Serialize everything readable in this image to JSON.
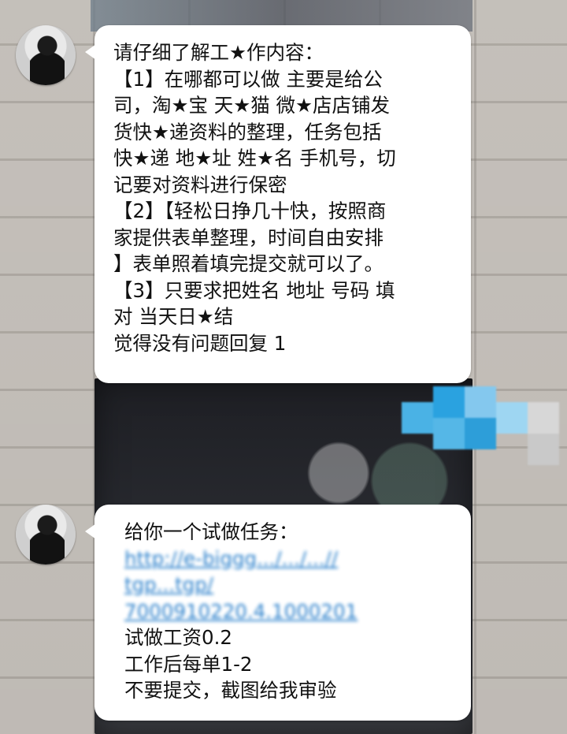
{
  "chat": {
    "messages": [
      {
        "sender_avatar": "avatar",
        "lines": [
          "请仔细了解工★作内容：",
          "【1】在哪都可以做   主要是给公",
          "司，淘★宝 天★猫 微★店店铺发",
          "货快★递资料的整理，任务包括",
          "快★递 地★址 姓★名 手机号，切",
          "记要对资料进行保密",
          "【2】【轻松日挣几十快，按照商",
          "家提供表单整理，时间自由安排",
          "】表单照着填完提交就可以了。",
          "【3】只要求把姓名 地址 号码 填",
          "对  当天日★结",
          "觉得没有问题回复  1"
        ]
      },
      {
        "sender_avatar": "avatar",
        "intro": "给你一个试做任务：",
        "blurred_link_lines": [
          "http://e-biggg.../.../...//",
          "tgp...tgp/",
          "7000910220.4.1000201"
        ],
        "tail_lines": [
          "试做工资0.2",
          "工作后每单1-2",
          "不要提交，截图给我审验"
        ]
      }
    ]
  },
  "colors": {
    "bubble_bg": "#ffffff",
    "text": "#111111",
    "link": "#1e78c8",
    "pixel_blur_blue": "#2aa2e0"
  }
}
